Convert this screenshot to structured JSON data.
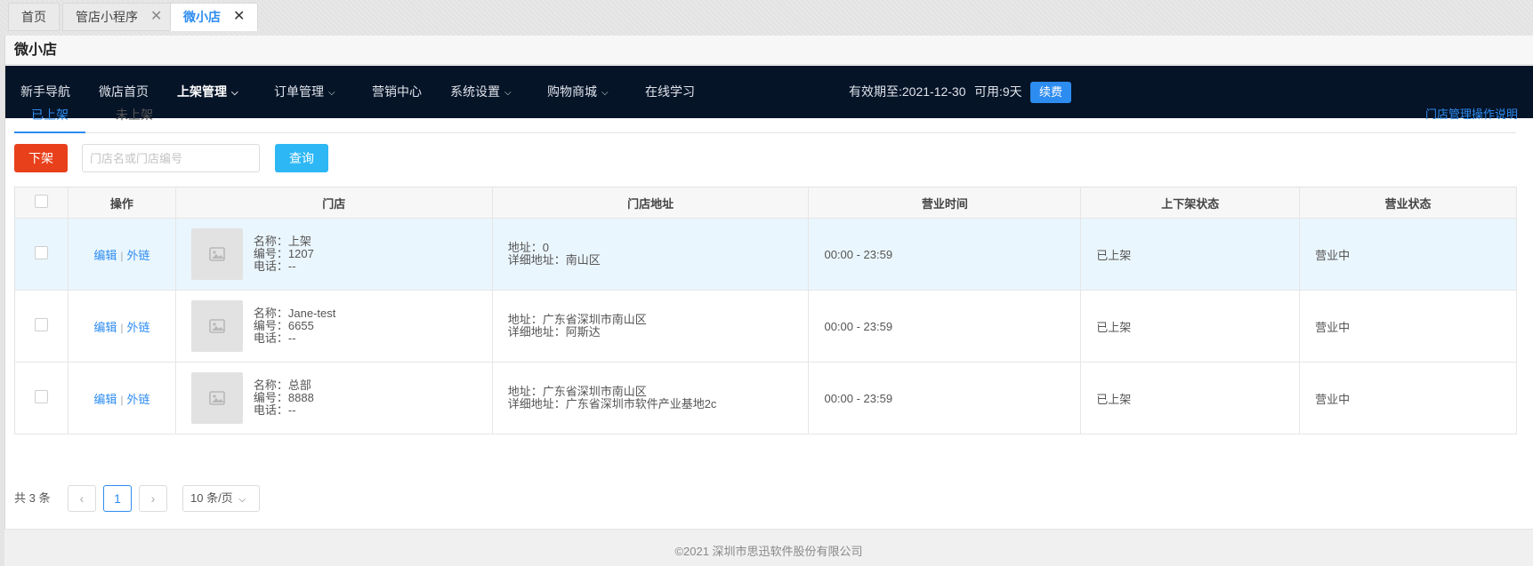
{
  "tabs": [
    {
      "label": "首页",
      "closable": false,
      "active": false
    },
    {
      "label": "管店小程序",
      "closable": true,
      "active": false
    },
    {
      "label": "微小店",
      "closable": true,
      "active": true
    }
  ],
  "page_title": "微小店",
  "nav": {
    "items": [
      {
        "label": "新手导航"
      },
      {
        "label": "微店首页"
      },
      {
        "label": "上架管理",
        "dropdown": true,
        "active": true
      },
      {
        "label": "订单管理",
        "dropdown": true
      },
      {
        "label": "营销中心"
      },
      {
        "label": "系统设置",
        "dropdown": true
      },
      {
        "label": "购物商城",
        "dropdown": true
      },
      {
        "label": "在线学习"
      }
    ],
    "validity_text": "有效期至:2021-12-30",
    "available_text": "可用:9天",
    "renew_label": "续费"
  },
  "subtabs": [
    "已上架",
    "未上架"
  ],
  "help_link": "门店管理操作说明",
  "toolbar": {
    "off_shelf_label": "下架",
    "search_placeholder": "门店名或门店编号",
    "query_label": "查询"
  },
  "table": {
    "headers": [
      "操作",
      "门店",
      "门店地址",
      "营业时间",
      "上下架状态",
      "营业状态"
    ],
    "edit_label": "编辑",
    "link_label": "外链",
    "rows": [
      {
        "name": "名称：上架",
        "code": "编号：1207",
        "phone": "电话：--",
        "address": "地址：0",
        "detail": "详细地址：南山区",
        "hours": "00:00 - 23:59",
        "shelf": "已上架",
        "status": "营业中"
      },
      {
        "name": "名称：Jane-test",
        "code": "编号：6655",
        "phone": "电话：--",
        "address": "地址：广东省深圳市南山区",
        "detail": "详细地址：阿斯达",
        "hours": "00:00 - 23:59",
        "shelf": "已上架",
        "status": "营业中"
      },
      {
        "name": "名称：总部",
        "code": "编号：8888",
        "phone": "电话：--",
        "address": "地址：广东省深圳市南山区",
        "detail": "详细地址：广东省深圳市软件产业基地2c",
        "hours": "00:00 - 23:59",
        "shelf": "已上架",
        "status": "营业中"
      }
    ]
  },
  "pagination": {
    "total": "共 3 条",
    "prev": "‹",
    "current": "1",
    "next": "›",
    "page_size": "10 条/页"
  },
  "footer": "©2021 深圳市思迅软件股份有限公司"
}
